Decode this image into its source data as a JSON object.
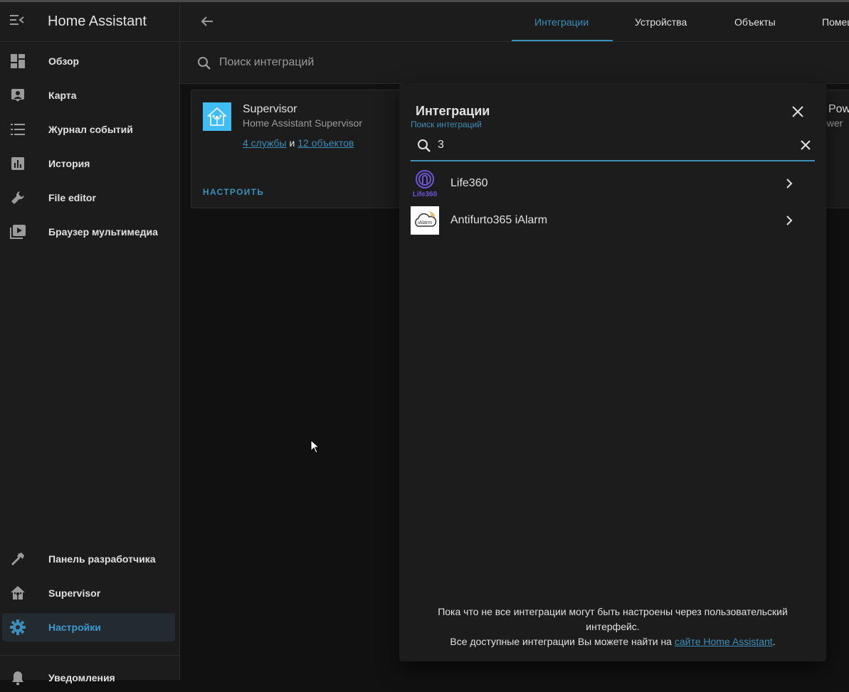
{
  "app": {
    "title": "Home Assistant"
  },
  "sidebar": {
    "items": [
      {
        "label": "Обзор",
        "icon": "dashboard-icon"
      },
      {
        "label": "Карта",
        "icon": "map-icon"
      },
      {
        "label": "Журнал событий",
        "icon": "logbook-icon"
      },
      {
        "label": "История",
        "icon": "history-icon"
      },
      {
        "label": "File editor",
        "icon": "wrench-icon"
      },
      {
        "label": "Браузер мультимедиа",
        "icon": "media-icon"
      }
    ],
    "bottom_items": [
      {
        "label": "Панель разработчика",
        "icon": "hammer-icon"
      },
      {
        "label": "Supervisor",
        "icon": "home-assistant-icon"
      },
      {
        "label": "Настройки",
        "icon": "gear-icon",
        "active": true
      },
      {
        "label": "Уведомления",
        "icon": "bell-icon"
      }
    ]
  },
  "topbar": {
    "tabs": [
      {
        "label": "Интеграции",
        "active": true
      },
      {
        "label": "Устройства"
      },
      {
        "label": "Объекты"
      },
      {
        "label": "Помещения"
      }
    ]
  },
  "search": {
    "placeholder": "Поиск интеграций"
  },
  "cards": [
    {
      "name": "Supervisor",
      "subtitle": "Home Assistant Supervisor",
      "services_link": "4 службы",
      "and": "и",
      "entities_link": "12 объектов",
      "configure": "НАСТРОИТЬ"
    },
    {
      "name": "Pow",
      "subtitle": "ower"
    }
  ],
  "dialog": {
    "title": "Интеграции",
    "search_label": "Поиск интеграций",
    "search_value": "3",
    "results": [
      {
        "name": "Life360",
        "icon": "life360-logo"
      },
      {
        "name": "Antifurto365 iAlarm",
        "icon": "ialarm-logo"
      }
    ],
    "footer_line1": "Пока что не все интеграции могут быть настроены через пользовательский интерфейс.",
    "footer_line2": "Все доступные интеграции Вы можете найти на",
    "footer_link": "сайте Home Assistant",
    "footer_end": "."
  },
  "colors": {
    "accent": "#3b8fb8",
    "background": "#111111",
    "surface": "#1c1c1c",
    "life360": "#6f55d6"
  }
}
